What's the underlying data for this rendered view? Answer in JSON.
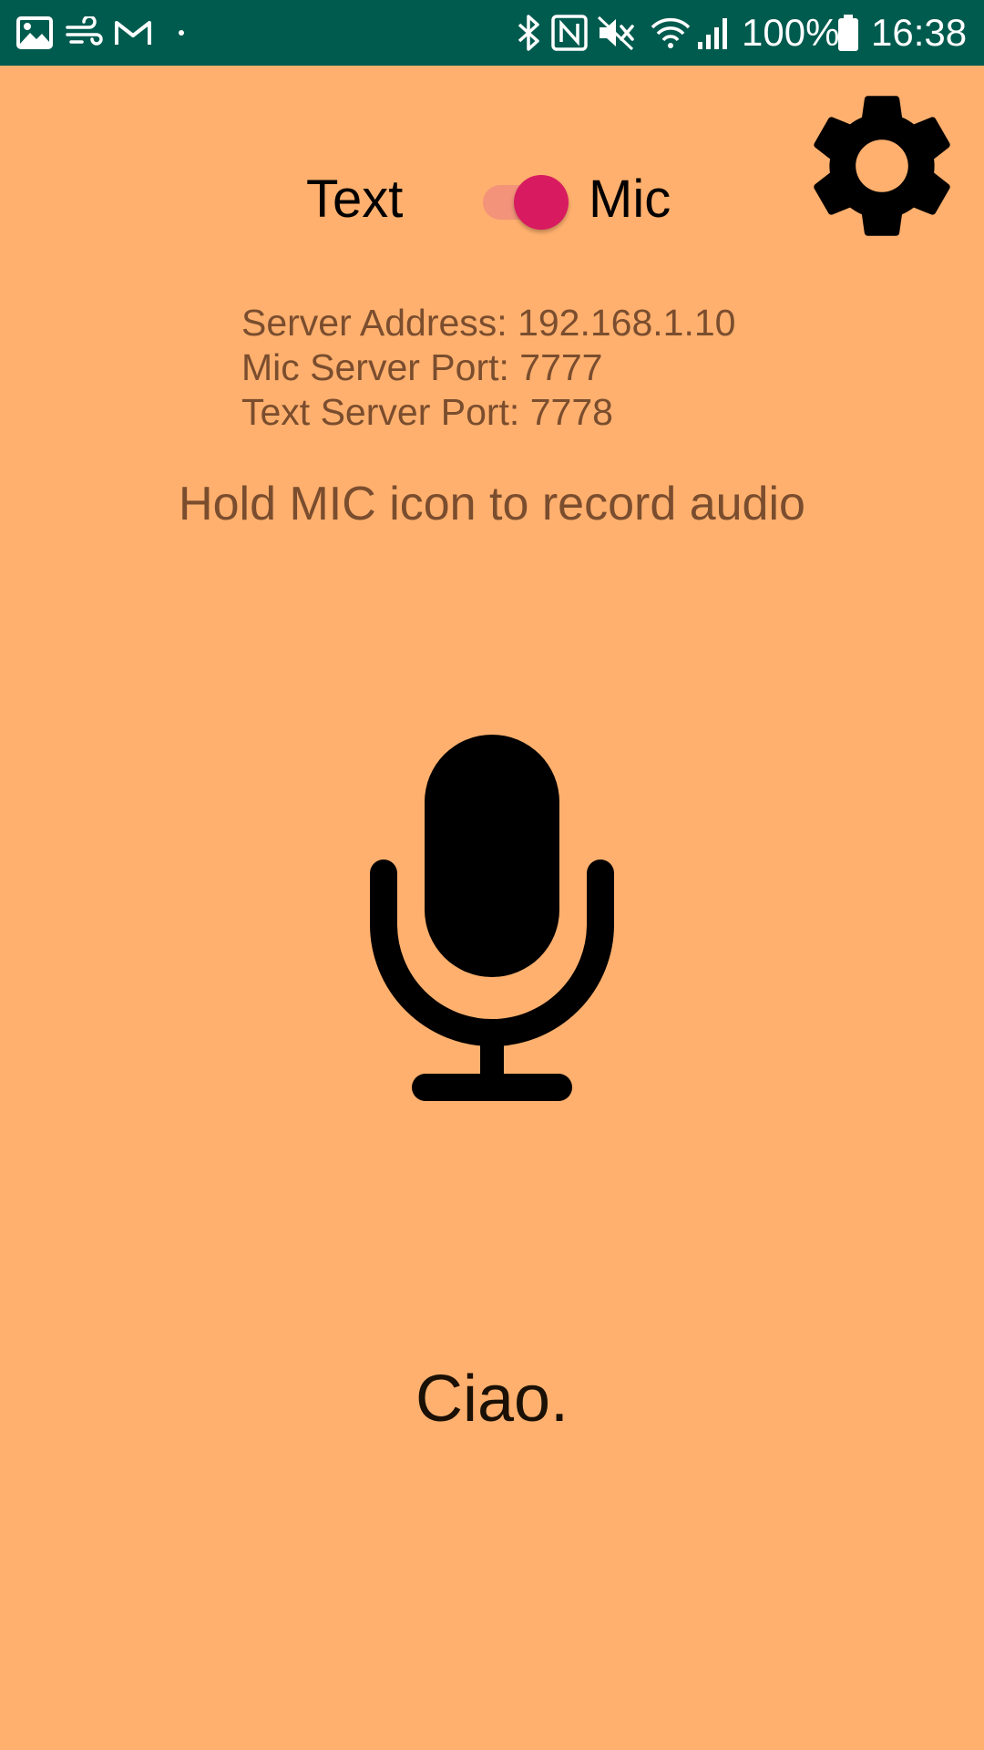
{
  "status_bar": {
    "battery": "100%",
    "time": "16:38",
    "icons": [
      "image-icon",
      "wind-icon",
      "gmail-icon",
      "dot-icon",
      "bluetooth-icon",
      "nfc-icon",
      "mute-icon",
      "wifi-icon",
      "signal-icon",
      "battery-icon"
    ]
  },
  "mode_toggle": {
    "left_label": "Text",
    "right_label": "Mic",
    "state": "Mic"
  },
  "settings": {
    "icon": "gear-icon"
  },
  "server_info": {
    "address_line": "Server Address: 192.168.1.10",
    "mic_port_line": "Mic Server Port: 7777",
    "text_port_line": "Text Server Port: 7778"
  },
  "hint": "Hold MIC icon to record audio",
  "mic": {
    "icon": "microphone-icon"
  },
  "result": "Ciao.",
  "colors": {
    "status_bar": "#005b4f",
    "background": "#ffb06e",
    "accent": "#d81b60",
    "track": "#f2937a",
    "info_text": "#7a4d2e"
  }
}
